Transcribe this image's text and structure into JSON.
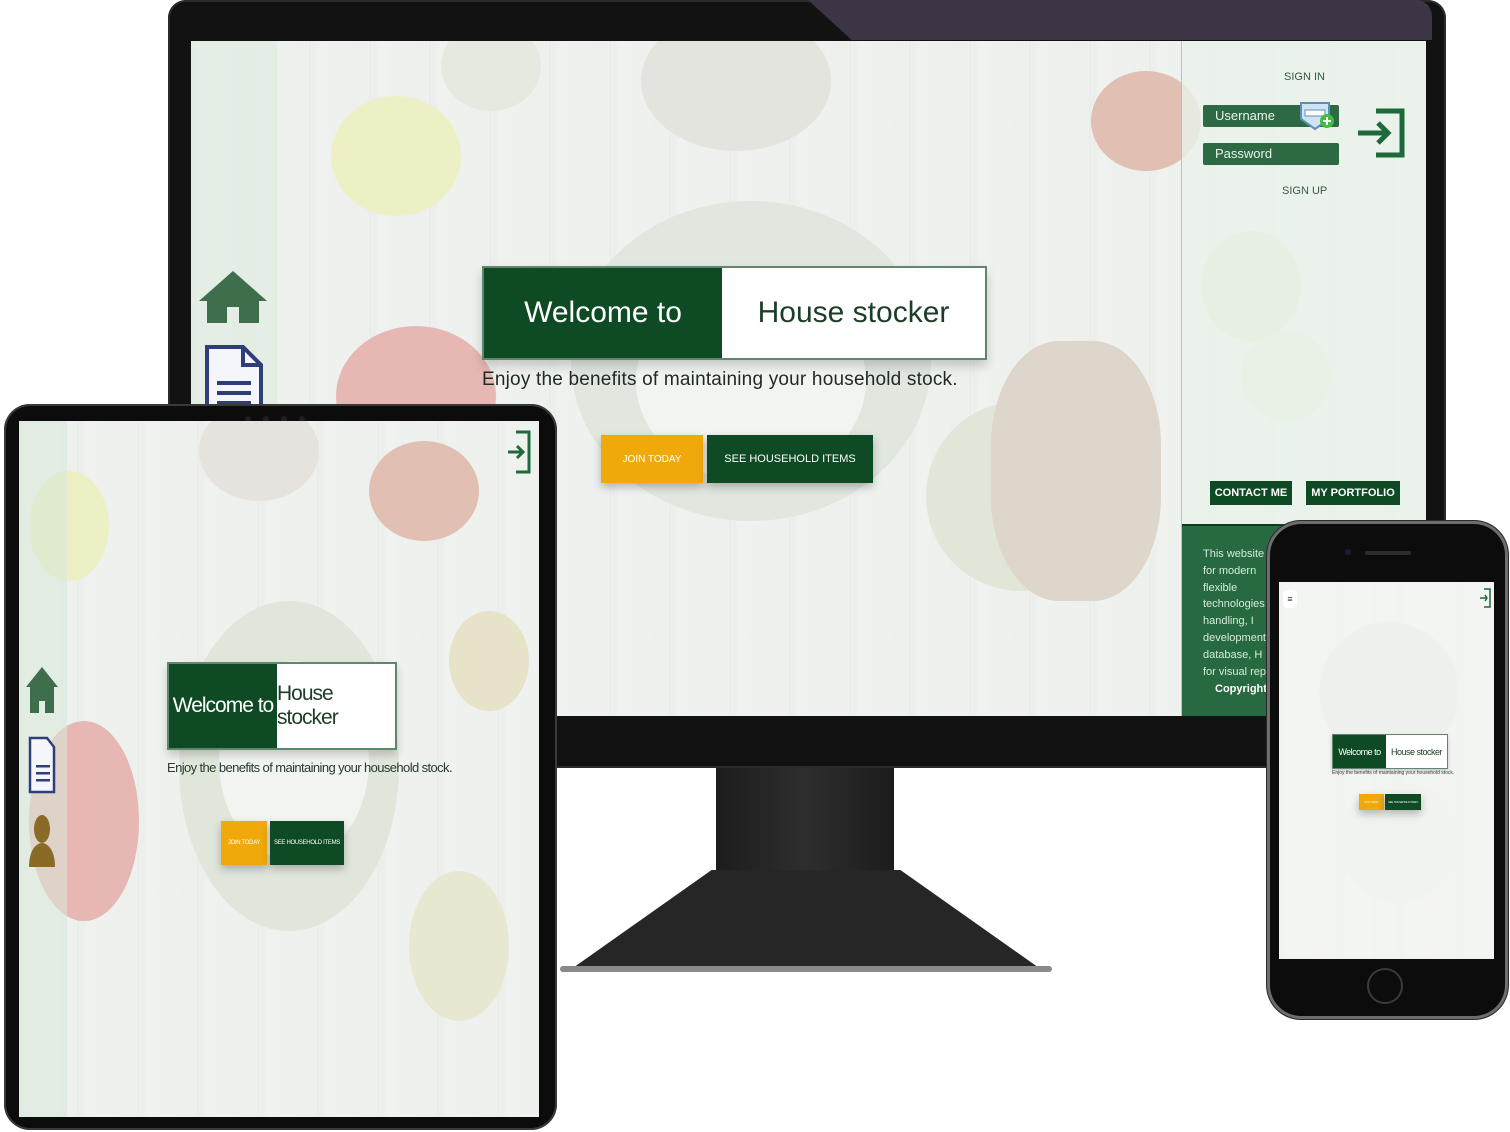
{
  "brand": {
    "welcome": "Welcome to",
    "name": "House stocker",
    "tagline": "Enjoy the benefits of maintaining your household stock."
  },
  "actions": {
    "join_label": "JOIN TODAY",
    "see_items_label": "SEE HOUSEHOLD ITEMS"
  },
  "auth": {
    "sign_in": "SIGN IN",
    "username_placeholder": "Username",
    "password_placeholder": "Password",
    "sign_up": "SIGN UP"
  },
  "links": {
    "contact": "CONTACT ME",
    "portfolio": "MY PORTFOLIO"
  },
  "footer": {
    "lines": [
      "This website",
      "for  modern",
      "flexible",
      "technologies",
      "handling,     I",
      "development",
      "database, H",
      "for visual rep"
    ],
    "copyright": "Copyright"
  },
  "nav": {
    "home_icon": "home-icon",
    "document_icon": "document-icon",
    "person_icon": "person-icon",
    "login_icon": "login-icon",
    "menu_icon": "menu-icon"
  },
  "colors": {
    "brand_green": "#0e4b25",
    "accent_gold": "#f0a90a",
    "panel_green": "#2d6a43"
  }
}
